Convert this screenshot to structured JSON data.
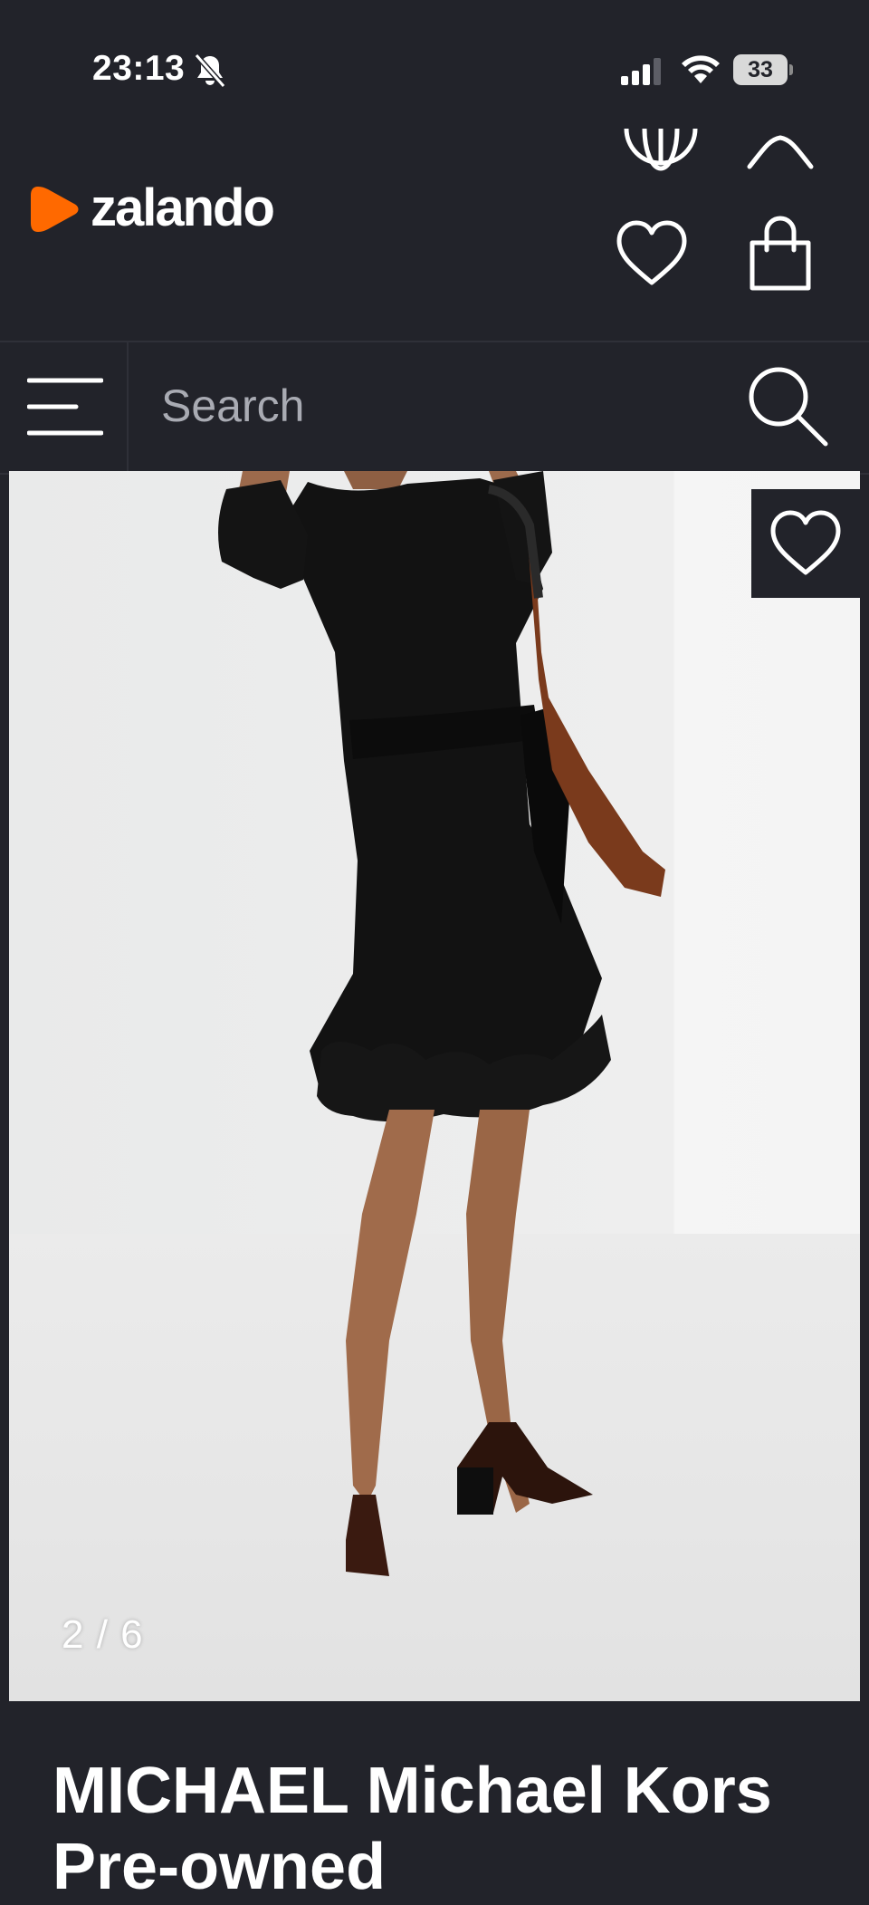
{
  "status_bar": {
    "time": "23:13",
    "battery": "33",
    "icons": [
      "bell-slash-icon",
      "cellular-signal-icon",
      "wifi-icon",
      "battery-icon"
    ]
  },
  "header": {
    "logo_text": "zalando",
    "brand_color": "#ff6900",
    "icons": [
      "globe-icon",
      "chevron-up-icon",
      "heart-icon",
      "shopping-bag-icon"
    ]
  },
  "search": {
    "placeholder": "Search",
    "icons": [
      "menu-icon",
      "search-icon"
    ]
  },
  "product": {
    "image_counter": "2 / 6",
    "title": "MICHAEL Michael Kors Pre-owned",
    "image_alt": "Black ruffled wrap mini dress"
  },
  "colors": {
    "background": "#22232a",
    "text": "#ffffff",
    "placeholder": "#a9abb3"
  }
}
